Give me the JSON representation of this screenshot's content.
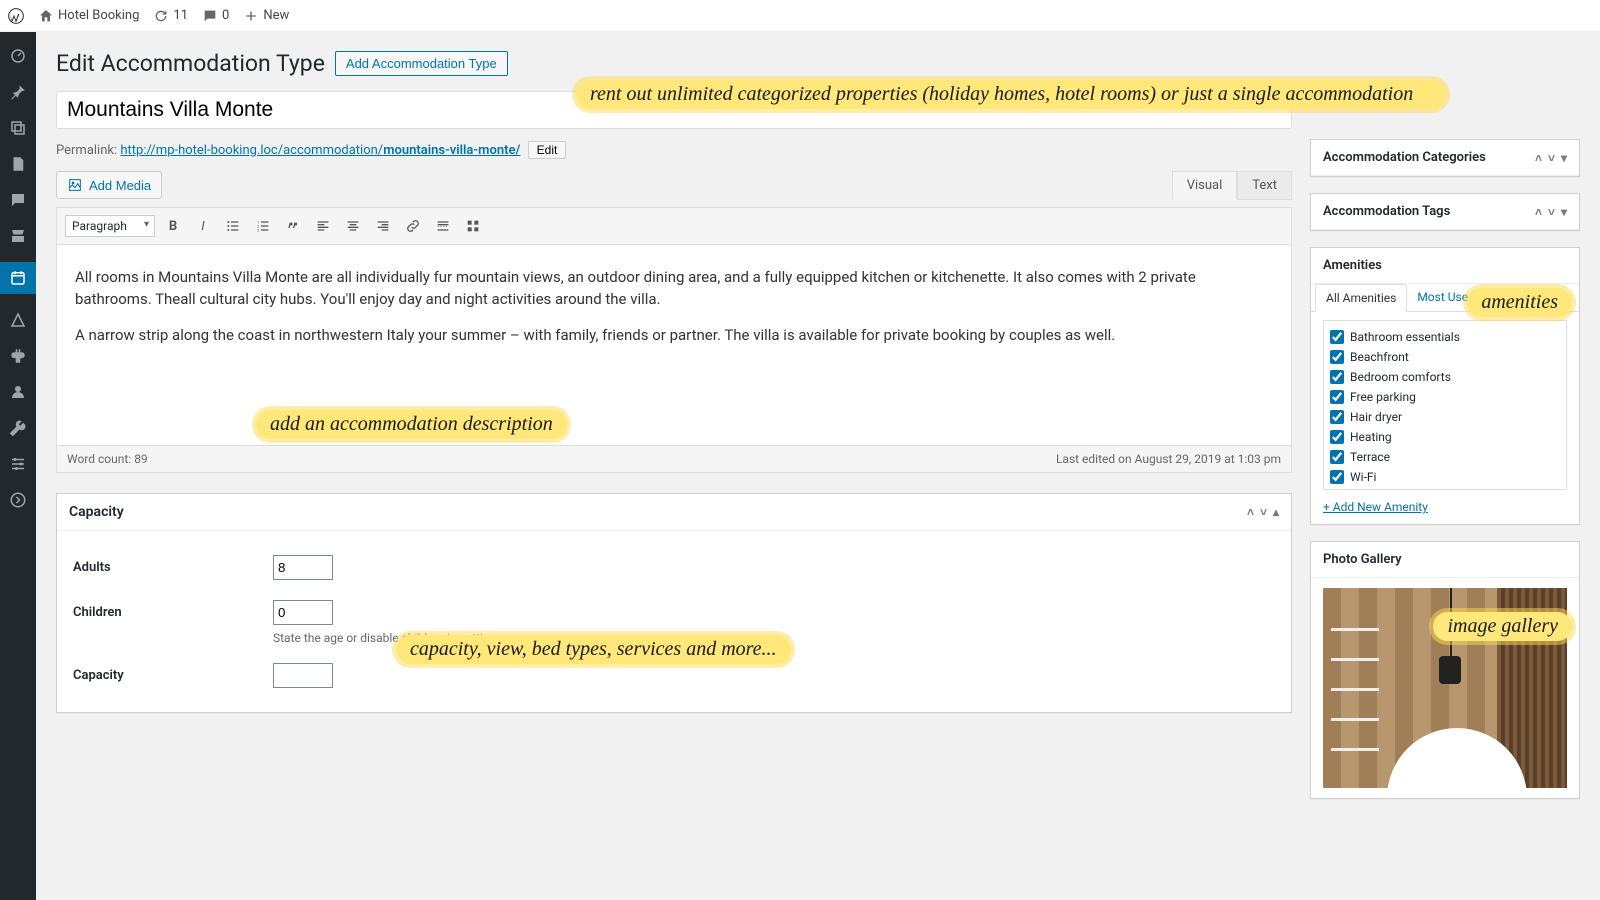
{
  "toolbar": {
    "site_name": "Hotel Booking",
    "updates_count": "11",
    "comments_count": "0",
    "new_label": "New"
  },
  "page": {
    "heading": "Edit Accommodation Type",
    "add_button": "Add Accommodation Type",
    "title_value": "Mountains Villa Monte",
    "permalink_label": "Permalink:",
    "permalink_base": "http://mp-hotel-booking.loc/accommodation/",
    "permalink_slug": "mountains-villa-monte/",
    "edit_button": "Edit",
    "add_media": "Add Media",
    "tab_visual": "Visual",
    "tab_text": "Text",
    "format_select": "Paragraph",
    "paragraph1": "All rooms in Mountains Villa Monte are all individually fur mountain views, an outdoor dining area, and a fully equipped kitchen or kitchenette. It also comes with 2 private bathrooms. Theall cultural city hubs. You'll enjoy day and night activities around the villa.",
    "paragraph2": "A narrow strip along the coast in northwestern Italy  your summer – with family, friends or partner. The villa is available for private booking by couples as well.",
    "word_count_label": "Word count: ",
    "word_count": "89",
    "last_edited": "Last edited on August 29, 2019 at 1:03 pm"
  },
  "capacity": {
    "title": "Capacity",
    "adults_label": "Adults",
    "adults_value": "8",
    "children_label": "Children",
    "children_value": "0",
    "children_hint_pre": "State the age or disable children in ",
    "children_hint_link": "settings",
    "capacity_label": "Capacity",
    "capacity_value": ""
  },
  "sidebar": {
    "categories_title": "Accommodation Categories",
    "tags_title": "Accommodation Tags",
    "amenities_title": "Amenities",
    "amenities_tab_all": "All Amenities",
    "amenities_tab_most": "Most Used",
    "amenities": [
      "Bathroom essentials",
      "Beachfront",
      "Bedroom comforts",
      "Free parking",
      "Hair dryer",
      "Heating",
      "Terrace",
      "Wi-Fi"
    ],
    "add_amenity": "+ Add New Amenity",
    "gallery_title": "Photo Gallery"
  },
  "annotations": {
    "a1": "rent out unlimited categorized properties (holiday homes, hotel rooms) or just a single accommodation",
    "a2": "add an accommodation description",
    "a3": "capacity, view, bed types, services and more...",
    "a4": "amenities",
    "a5": "image gallery"
  }
}
